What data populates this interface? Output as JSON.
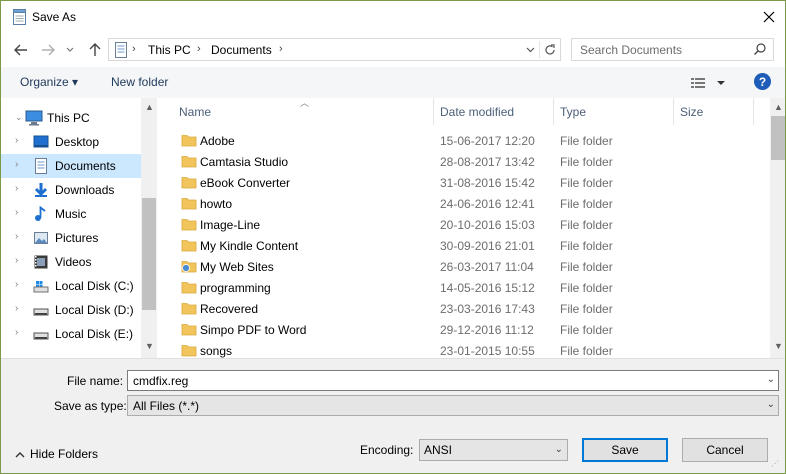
{
  "window": {
    "title": "Save As"
  },
  "address": {
    "segments": [
      "This PC",
      "Documents"
    ],
    "search_placeholder": "Search Documents"
  },
  "toolbar": {
    "organize": "Organize ▾",
    "new_folder": "New folder",
    "help": "?"
  },
  "nav": {
    "items": [
      {
        "label": "This PC",
        "icon": "computer-icon"
      },
      {
        "label": "Desktop",
        "icon": "desktop-icon"
      },
      {
        "label": "Documents",
        "icon": "documents-icon",
        "selected": true
      },
      {
        "label": "Downloads",
        "icon": "downloads-icon"
      },
      {
        "label": "Music",
        "icon": "music-icon"
      },
      {
        "label": "Pictures",
        "icon": "pictures-icon"
      },
      {
        "label": "Videos",
        "icon": "videos-icon"
      },
      {
        "label": "Local Disk (C:)",
        "icon": "drive-c-icon"
      },
      {
        "label": "Local Disk (D:)",
        "icon": "drive-icon"
      },
      {
        "label": "Local Disk (E:)",
        "icon": "drive-icon"
      }
    ]
  },
  "list": {
    "columns": [
      "Name",
      "Date modified",
      "Type",
      "Size"
    ],
    "rows": [
      {
        "name": "Adobe",
        "date": "15-06-2017 12:20",
        "type": "File folder"
      },
      {
        "name": "Camtasia Studio",
        "date": "28-08-2017 13:42",
        "type": "File folder"
      },
      {
        "name": "eBook Converter",
        "date": "31-08-2016 15:42",
        "type": "File folder"
      },
      {
        "name": "howto",
        "date": "24-06-2016 12:41",
        "type": "File folder"
      },
      {
        "name": "Image-Line",
        "date": "20-10-2016 15:03",
        "type": "File folder"
      },
      {
        "name": "My Kindle Content",
        "date": "30-09-2016 21:01",
        "type": "File folder"
      },
      {
        "name": "My Web Sites",
        "date": "26-03-2017 11:04",
        "type": "File folder",
        "special": true
      },
      {
        "name": "programming",
        "date": "14-05-2016 15:12",
        "type": "File folder"
      },
      {
        "name": "Recovered",
        "date": "23-03-2016 17:43",
        "type": "File folder"
      },
      {
        "name": "Simpo PDF to Word",
        "date": "29-12-2016 11:12",
        "type": "File folder"
      },
      {
        "name": "songs",
        "date": "23-01-2015 10:55",
        "type": "File folder"
      }
    ]
  },
  "form": {
    "file_name_label": "File name:",
    "file_name_value": "cmdfix.reg",
    "save_type_label": "Save as type:",
    "save_type_value": "All Files  (*.*)",
    "hide_folders": "Hide Folders",
    "encoding_label": "Encoding:",
    "encoding_value": "ANSI",
    "save_button": "Save",
    "cancel_button": "Cancel"
  },
  "colors": {
    "folder": "#f2c55c",
    "accent": "#0078d7",
    "selection": "#cce8ff"
  }
}
